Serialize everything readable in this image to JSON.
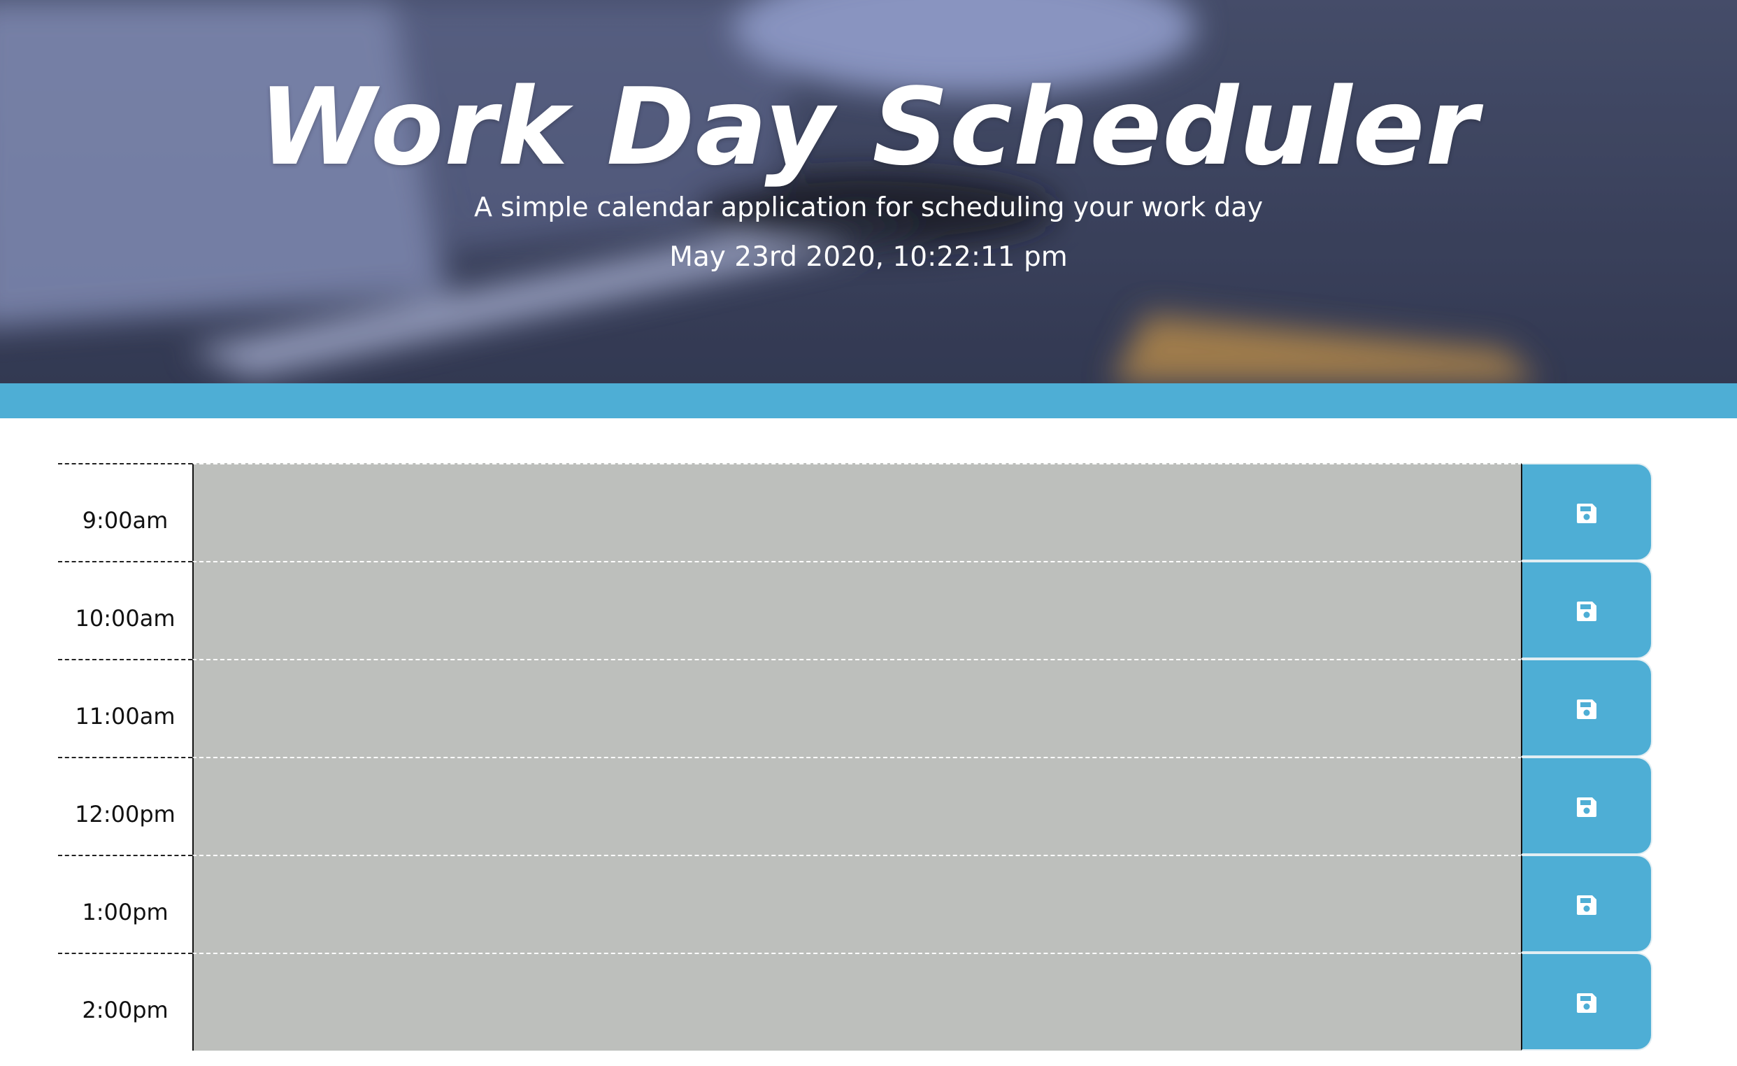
{
  "header": {
    "title": "Work Day Scheduler",
    "subtitle": "A simple calendar application for scheduling your work day",
    "current_datetime": "May 23rd 2020, 10:22:11 pm"
  },
  "schedule": {
    "rows": [
      {
        "hour": "9:00am",
        "description": "",
        "save_icon": "save-icon"
      },
      {
        "hour": "10:00am",
        "description": "",
        "save_icon": "save-icon"
      },
      {
        "hour": "11:00am",
        "description": "",
        "save_icon": "save-icon"
      },
      {
        "hour": "12:00pm",
        "description": "",
        "save_icon": "save-icon"
      },
      {
        "hour": "1:00pm",
        "description": "",
        "save_icon": "save-icon"
      },
      {
        "hour": "2:00pm",
        "description": "",
        "save_icon": "save-icon"
      }
    ]
  },
  "colors": {
    "accent": "#4eaed5",
    "past_block": "#bdbfbc",
    "header_bg": "#3e4561"
  }
}
